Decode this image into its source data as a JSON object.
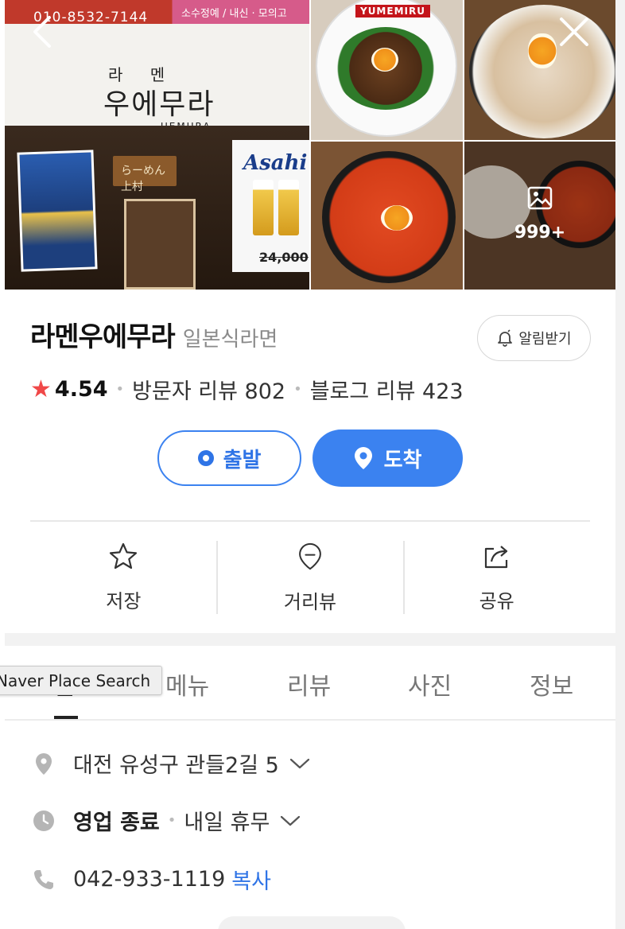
{
  "nav": {
    "back_icon": "chevron-left-icon",
    "close_icon": "close-icon"
  },
  "photos": {
    "storefront_sign": {
      "phone": "010-8532-7144",
      "subtitle": "소수정예 / 내신 · 모의고",
      "kor_small": "라 멘",
      "kor_large": "우에무라",
      "eng": "UEMURA",
      "noren": "らーめん 上村",
      "poster_brand": "Asahi",
      "poster_price": "24,000"
    },
    "food_brand": "YUMEMIRU",
    "more_count": "999+"
  },
  "place": {
    "name": "라멘우에무라",
    "category": "일본식라면",
    "notify_label": "알림받기",
    "rating": "4.54",
    "visitor_reviews": "방문자 리뷰 802",
    "blog_reviews": "블로그 리뷰 423"
  },
  "route": {
    "depart_label": "출발",
    "arrive_label": "도착"
  },
  "actions": [
    {
      "label": "저장",
      "icon": "star-outline-icon"
    },
    {
      "label": "거리뷰",
      "icon": "map-pin-outline-icon"
    },
    {
      "label": "공유",
      "icon": "share-icon"
    }
  ],
  "tabs": [
    "홈",
    "메뉴",
    "리뷰",
    "사진",
    "정보"
  ],
  "tooltip": "Naver Place Search",
  "info": {
    "address": "대전 유성구 관들2길 5",
    "hours": "영업 종료",
    "hours_note": "내일 휴무",
    "phone": "042-933-1119",
    "copy_label": "복사"
  },
  "colors": {
    "accent": "#3b82f0",
    "rating_star": "#f04848"
  }
}
